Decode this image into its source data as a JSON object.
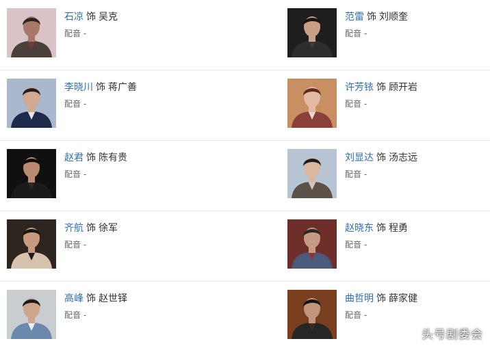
{
  "cast": [
    {
      "actor": "石凉",
      "as": "饰",
      "role": "吴克",
      "dub_label": "配音",
      "dub_value": "-",
      "photo": {
        "bg": "#d9c3c6",
        "skin": "#a8786a",
        "hair": "#2a2320",
        "cloth": "#4a3f3a",
        "accent": "#7a3a34"
      }
    },
    {
      "actor": "范雷",
      "as": "饰",
      "role": "刘顺奎",
      "dub_label": "配音",
      "dub_value": "-",
      "photo": {
        "bg": "#1e1e1e",
        "skin": "#c99f86",
        "hair": "#151515",
        "cloth": "#2d2d2d",
        "accent": "#3a3a3a"
      }
    },
    {
      "actor": "李晓川",
      "as": "饰",
      "role": "蒋广善",
      "dub_label": "配音",
      "dub_value": "-",
      "photo": {
        "bg": "#a9b8cc",
        "skin": "#d2a98f",
        "hair": "#1f1f1f",
        "cloth": "#1d2a4a",
        "accent": "#e6e6e6"
      }
    },
    {
      "actor": "许芳铱",
      "as": "饰",
      "role": "顾开岩",
      "dub_label": "配音",
      "dub_value": "-",
      "photo": {
        "bg": "#c98f62",
        "skin": "#e2b9a2",
        "hair": "#5a2d1c",
        "cloth": "#8a3f3a",
        "accent": "#e9d9c9"
      }
    },
    {
      "actor": "赵君",
      "as": "饰",
      "role": "陈有贵",
      "dub_label": "配音",
      "dub_value": "-",
      "photo": {
        "bg": "#101010",
        "skin": "#b98a70",
        "hair": "#0c0c0c",
        "cloth": "#1a1a1a",
        "accent": "#2a2a2a"
      }
    },
    {
      "actor": "刘显达",
      "as": "饰",
      "role": "汤志远",
      "dub_label": "配音",
      "dub_value": "-",
      "photo": {
        "bg": "#b6c4d3",
        "skin": "#dcb7a0",
        "hair": "#1d1d1d",
        "cloth": "#5b5148",
        "accent": "#cfc6bd"
      }
    },
    {
      "actor": "齐航",
      "as": "饰",
      "role": "徐军",
      "dub_label": "配音",
      "dub_value": "-",
      "photo": {
        "bg": "#2e2420",
        "skin": "#c89a80",
        "hair": "#1a1410",
        "cloth": "#d7c3ad",
        "accent": "#1b1b1b"
      }
    },
    {
      "actor": "赵晓东",
      "as": "饰",
      "role": "程勇",
      "dub_label": "配音",
      "dub_value": "-",
      "photo": {
        "bg": "#6e2e2a",
        "skin": "#c59b84",
        "hair": "#2c2624",
        "cloth": "#4b5a7a",
        "accent": "#8a3a34"
      }
    },
    {
      "actor": "高峰",
      "as": "饰",
      "role": "赵世铎",
      "dub_label": "配音",
      "dub_value": "-",
      "photo": {
        "bg": "#c8cdd2",
        "skin": "#cfa48c",
        "hair": "#1a1a1a",
        "cloth": "#6a89ad",
        "accent": "#f2f2f2"
      }
    },
    {
      "actor": "曲哲明",
      "as": "饰",
      "role": "薛家健",
      "dub_label": "配音",
      "dub_value": "-",
      "photo": {
        "bg": "#7a3f1f",
        "skin": "#c2967c",
        "hair": "#161616",
        "cloth": "#262626",
        "accent": "#3c2a1c"
      }
    }
  ],
  "watermark": "头号剧委会"
}
